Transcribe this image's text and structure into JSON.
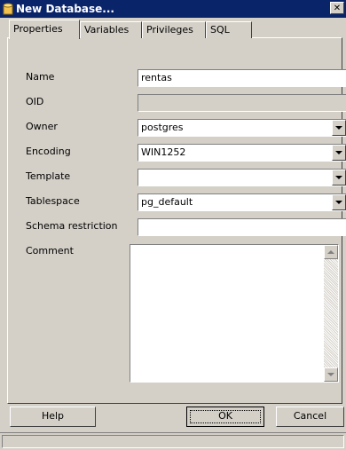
{
  "window": {
    "title": "New Database...",
    "close_glyph": "✕",
    "icon": "database-icon",
    "title_bar_color": "#0a246a"
  },
  "tabs": [
    {
      "label": "Properties",
      "active": true
    },
    {
      "label": "Variables",
      "active": false
    },
    {
      "label": "Privileges",
      "active": false
    },
    {
      "label": "SQL",
      "active": false
    }
  ],
  "form": {
    "name": {
      "label": "Name",
      "value": "rentas"
    },
    "oid": {
      "label": "OID",
      "value": ""
    },
    "owner": {
      "label": "Owner",
      "value": "postgres"
    },
    "encoding": {
      "label": "Encoding",
      "value": "WIN1252"
    },
    "template": {
      "label": "Template",
      "value": ""
    },
    "tablespace": {
      "label": "Tablespace",
      "value": "pg_default"
    },
    "schema_restriction": {
      "label": "Schema restriction",
      "value": ""
    },
    "comment": {
      "label": "Comment",
      "value": ""
    }
  },
  "buttons": {
    "help": "Help",
    "ok": "OK",
    "cancel": "Cancel"
  },
  "status": {
    "text": ""
  }
}
